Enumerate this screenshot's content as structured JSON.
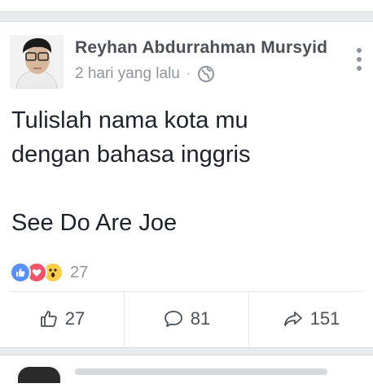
{
  "post": {
    "author": "Reyhan Abdurrahman Mursyid",
    "time": "2 hari yang lalu",
    "privacy_icon": "globe-icon",
    "text": "Tulislah nama kota mu\ndengan bahasa inggris\n\nSee Do Are Joe",
    "reactions": {
      "icons": [
        "like",
        "love",
        "wow"
      ],
      "count": "27"
    },
    "actions": {
      "like_count": "27",
      "comment_count": "81",
      "share_count": "151"
    }
  },
  "colors": {
    "like": "#5890ff",
    "love": "#f25268",
    "wow": "#fbcd48",
    "meta": "#90949c"
  }
}
